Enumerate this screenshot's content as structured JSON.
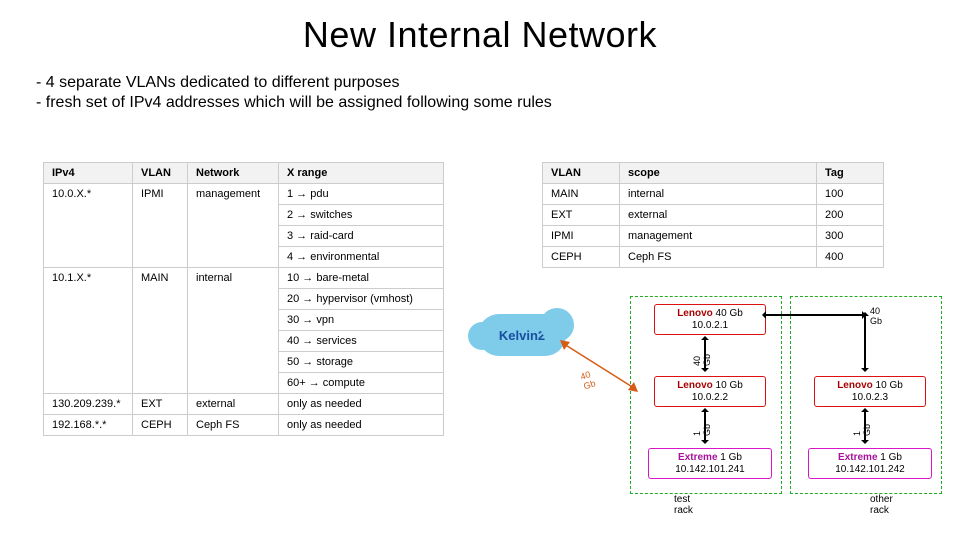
{
  "title": "New Internal Network",
  "bullets": [
    "4 separate VLANs dedicated to different purposes",
    "fresh set of IPv4 addresses which will be assigned following some rules"
  ],
  "left_table": {
    "headers": [
      "IPv4",
      "VLAN",
      "Network",
      "X range"
    ],
    "rows": [
      [
        "10.0.X.*",
        "IPMI",
        "management",
        "1 → pdu"
      ],
      [
        "",
        "",
        "",
        "2 → switches"
      ],
      [
        "",
        "",
        "",
        "3 → raid-card"
      ],
      [
        "",
        "",
        "",
        "4 → environmental"
      ],
      [
        "10.1.X.*",
        "MAIN",
        "internal",
        "10 → bare-metal"
      ],
      [
        "",
        "",
        "",
        "20 → hypervisor (vmhost)"
      ],
      [
        "",
        "",
        "",
        "30 → vpn"
      ],
      [
        "",
        "",
        "",
        "40 → services"
      ],
      [
        "",
        "",
        "",
        "50 → storage"
      ],
      [
        "",
        "",
        "",
        "60+ → compute"
      ],
      [
        "130.209.239.*",
        "EXT",
        "external",
        "only as needed"
      ],
      [
        "192.168.*.*",
        "CEPH",
        "Ceph FS",
        "only as needed"
      ]
    ]
  },
  "right_table": {
    "headers": [
      "VLAN",
      "scope",
      "Tag"
    ],
    "rows": [
      [
        "MAIN",
        "internal",
        "100"
      ],
      [
        "EXT",
        "external",
        "200"
      ],
      [
        "IPMI",
        "management",
        "300"
      ],
      [
        "CEPH",
        "Ceph FS",
        "400"
      ]
    ]
  },
  "diagram": {
    "cloud": "Kelvin2",
    "link_cloud": "40 Gb",
    "link_top": "40 Gb",
    "rack1": {
      "label": "test rack",
      "nodes": [
        {
          "brand": "Lenovo",
          "speed": "40 Gb",
          "ip": "10.0.2.1",
          "style": "red"
        },
        {
          "brand": "Lenovo",
          "speed": "10 Gb",
          "ip": "10.0.2.2",
          "style": "red"
        },
        {
          "brand": "Extreme",
          "speed": "1 Gb",
          "ip": "10.142.101.241",
          "style": "magenta"
        }
      ],
      "link12": "40 Gb",
      "link23": "1 Gb"
    },
    "rack2": {
      "label": "other rack",
      "nodes": [
        {
          "brand": "Lenovo",
          "speed": "10 Gb",
          "ip": "10.0.2.3",
          "style": "red"
        },
        {
          "brand": "Extreme",
          "speed": "1 Gb",
          "ip": "10.142.101.242",
          "style": "magenta"
        }
      ],
      "link12": "1 Gb"
    }
  }
}
